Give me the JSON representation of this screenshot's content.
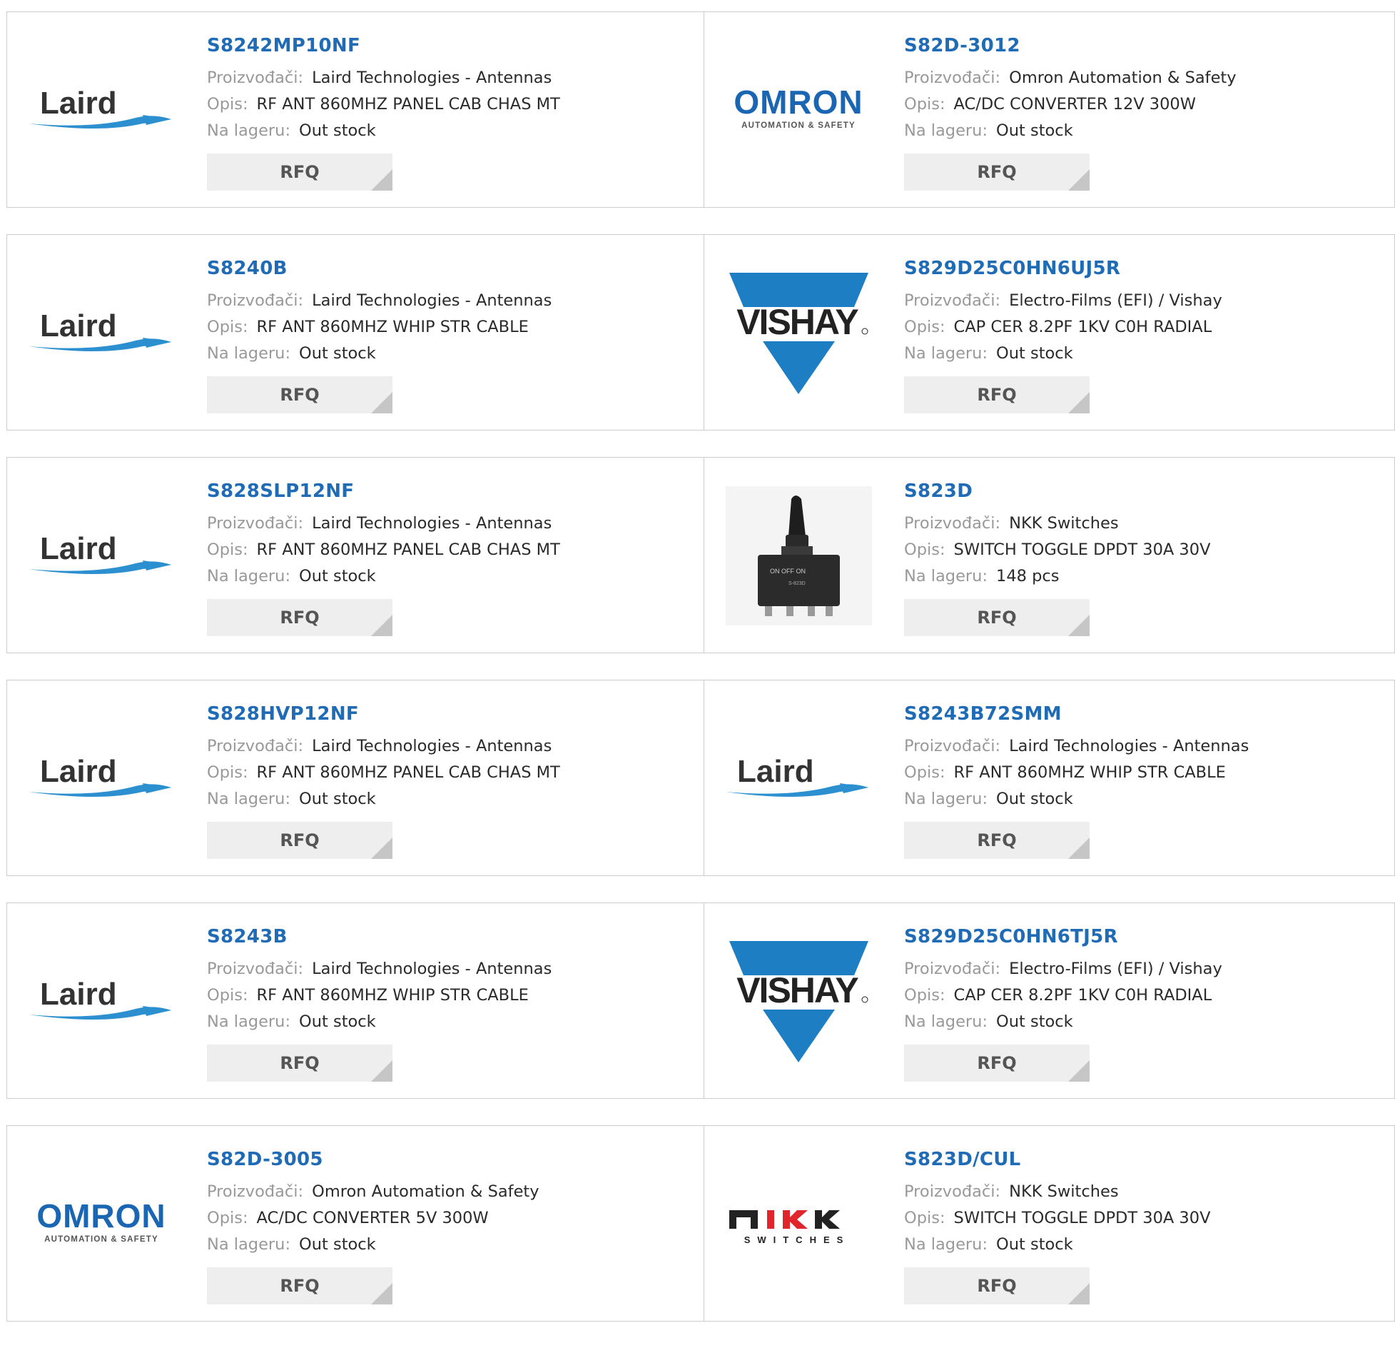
{
  "labels": {
    "manufacturer": "Proizvođači:",
    "description": "Opis:",
    "stock": "Na lageru:",
    "rfq": "RFQ"
  },
  "logos": {
    "laird": "Laird",
    "omron": "OMRON",
    "omron_sub": "AUTOMATION & SAFETY",
    "vishay": "VISHAY",
    "nkk": "NKK",
    "nkk_sub": "SWITCHES"
  },
  "colors": {
    "part_link": "#1f6bb5",
    "label": "#999999",
    "button_bg": "#eeeeee",
    "border": "#cccccc",
    "omron_blue": "#1a66b3",
    "vishay_blue": "#1d7ec4"
  },
  "products": [
    {
      "part": "S8242MP10NF",
      "logo": "laird-logo",
      "manufacturer": "Laird Technologies - Antennas",
      "description": "RF ANT 860MHZ PANEL CAB CHAS MT",
      "stock": "Out stock"
    },
    {
      "part": "S82D-3012",
      "logo": "omron-logo",
      "manufacturer": "Omron Automation & Safety",
      "description": "AC/DC CONVERTER 12V 300W",
      "stock": "Out stock"
    },
    {
      "part": "S8240B",
      "logo": "laird-logo",
      "manufacturer": "Laird Technologies - Antennas",
      "description": "RF ANT 860MHZ WHIP STR CABLE",
      "stock": "Out stock"
    },
    {
      "part": "S829D25C0HN6UJ5R",
      "logo": "vishay-logo",
      "manufacturer": "Electro-Films (EFI) / Vishay",
      "description": "CAP CER 8.2PF 1KV C0H RADIAL",
      "stock": "Out stock"
    },
    {
      "part": "S828SLP12NF",
      "logo": "laird-logo",
      "manufacturer": "Laird Technologies - Antennas",
      "description": "RF ANT 860MHZ PANEL CAB CHAS MT",
      "stock": "Out stock"
    },
    {
      "part": "S823D",
      "logo": "toggle-switch-photo",
      "manufacturer": "NKK Switches",
      "description": "SWITCH TOGGLE DPDT 30A 30V",
      "stock": "148 pcs"
    },
    {
      "part": "S828HVP12NF",
      "logo": "laird-logo",
      "manufacturer": "Laird Technologies - Antennas",
      "description": "RF ANT 860MHZ PANEL CAB CHAS MT",
      "stock": "Out stock"
    },
    {
      "part": "S8243B72SMM",
      "logo": "laird-logo",
      "manufacturer": "Laird Technologies - Antennas",
      "description": "RF ANT 860MHZ WHIP STR CABLE",
      "stock": "Out stock"
    },
    {
      "part": "S8243B",
      "logo": "laird-logo",
      "manufacturer": "Laird Technologies - Antennas",
      "description": "RF ANT 860MHZ WHIP STR CABLE",
      "stock": "Out stock"
    },
    {
      "part": "S829D25C0HN6TJ5R",
      "logo": "vishay-logo",
      "manufacturer": "Electro-Films (EFI) / Vishay",
      "description": "CAP CER 8.2PF 1KV C0H RADIAL",
      "stock": "Out stock"
    },
    {
      "part": "S82D-3005",
      "logo": "omron-logo",
      "manufacturer": "Omron Automation & Safety",
      "description": "AC/DC CONVERTER 5V 300W",
      "stock": "Out stock"
    },
    {
      "part": "S823D/CUL",
      "logo": "nkk-logo",
      "manufacturer": "NKK Switches",
      "description": "SWITCH TOGGLE DPDT 30A 30V",
      "stock": "Out stock"
    }
  ]
}
